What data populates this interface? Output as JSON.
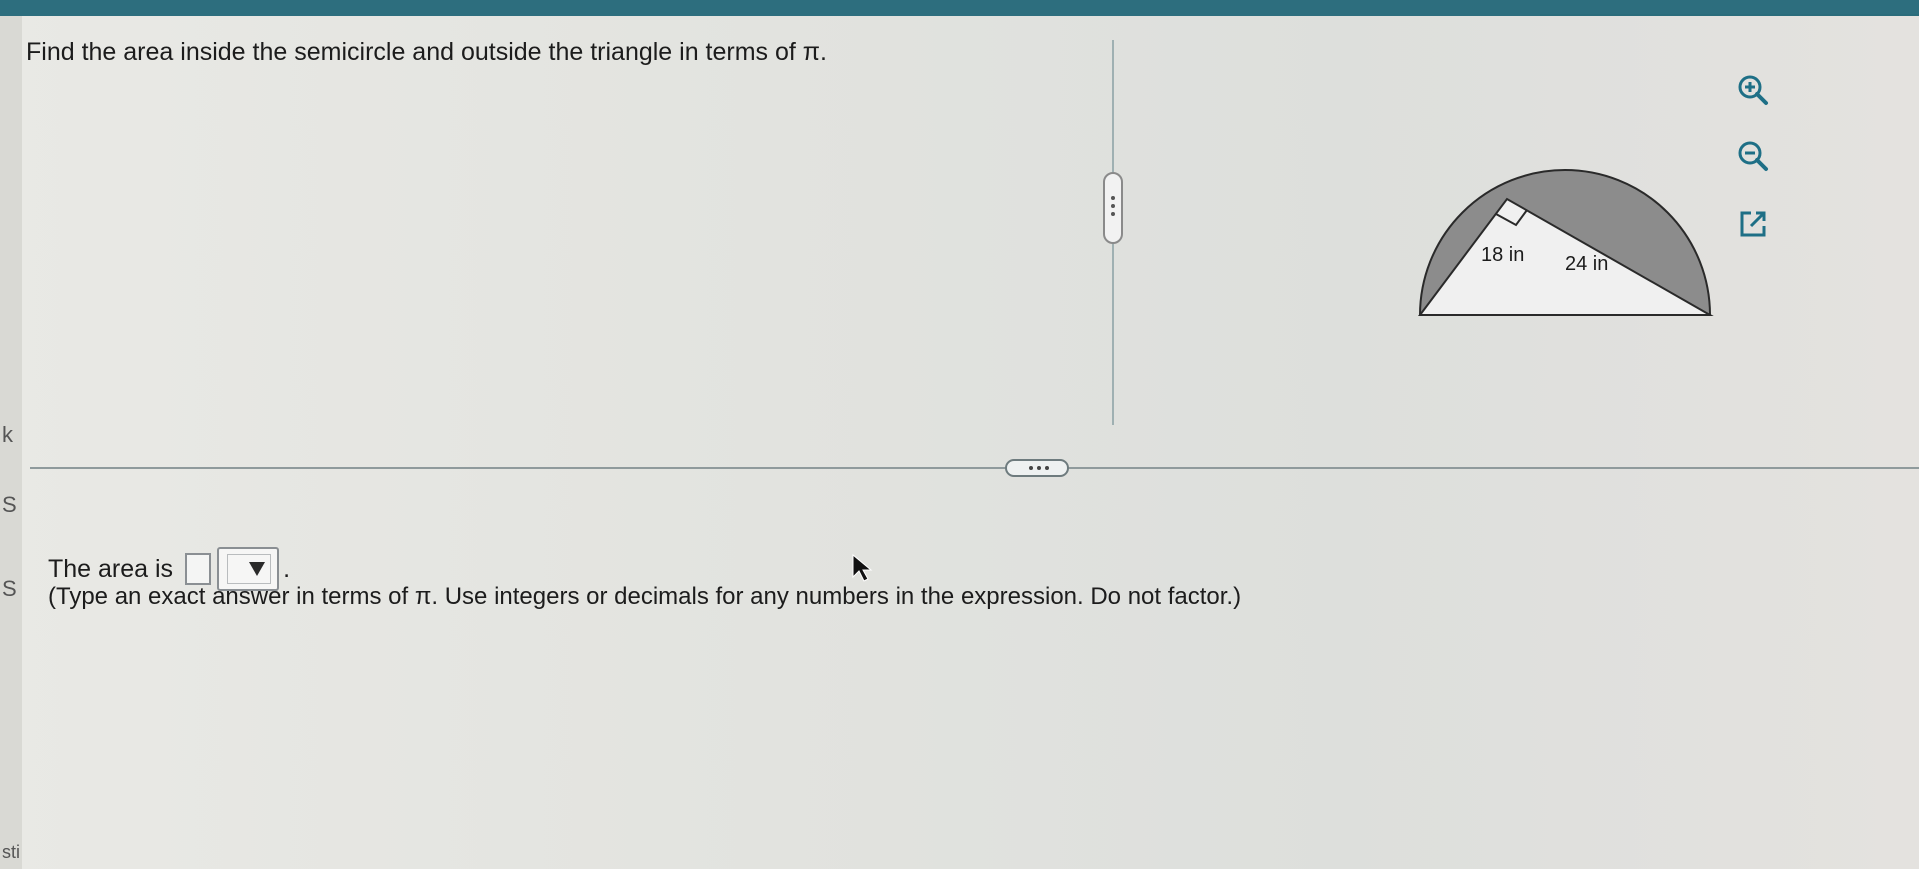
{
  "question": {
    "text": "Find the area inside the semicircle and outside the triangle in terms of π."
  },
  "figure": {
    "leg_label_1": "18 in",
    "leg_label_2": "24 in",
    "shaded_color": "#8c8c8c",
    "triangle_color": "#f0f0f0"
  },
  "toolbar": {
    "zoom_in_icon": "zoom-in-icon",
    "zoom_out_icon": "zoom-out-icon",
    "popout_icon": "external-link-icon",
    "icon_color": "#1e6f86"
  },
  "answer": {
    "prefix": "The area is",
    "value": "",
    "unit_selected": "",
    "suffix": "."
  },
  "hint": {
    "text": "(Type an exact answer in terms of π. Use integers or decimals for any numbers in the expression. Do not factor.)"
  },
  "edge_letters": [
    "k",
    "S",
    "S",
    "sti"
  ],
  "colors": {
    "top_bar": "#2d6e7e",
    "background": "#e3e3de"
  }
}
